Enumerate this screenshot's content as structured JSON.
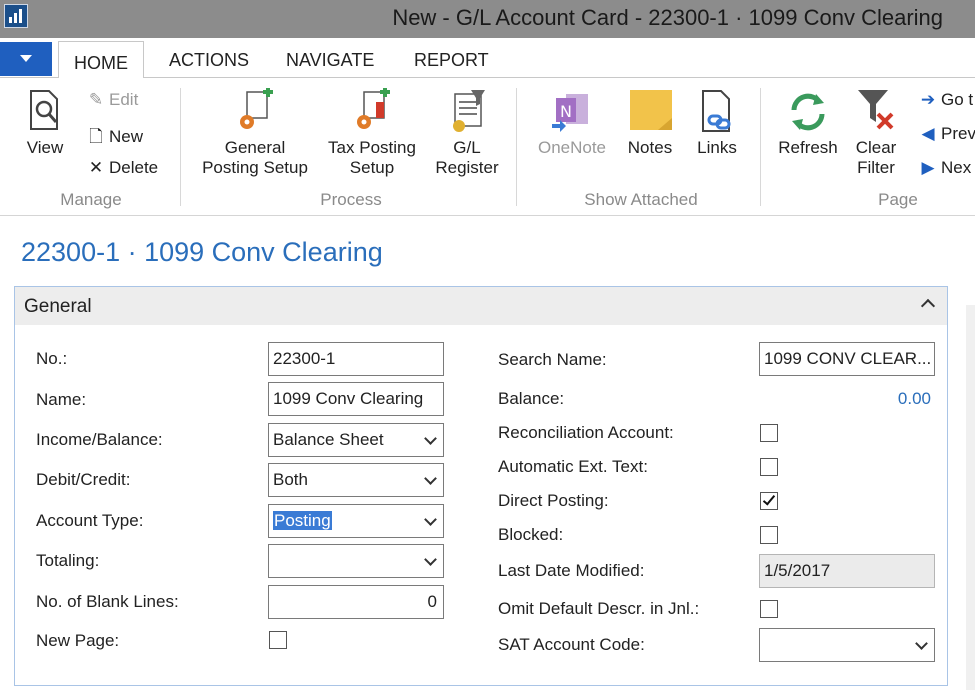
{
  "window": {
    "title": "New - G/L Account Card - 22300-1 · 1099 Conv Clearing"
  },
  "tabs": [
    "HOME",
    "ACTIONS",
    "NAVIGATE",
    "REPORT"
  ],
  "ribbon": {
    "manage": {
      "label": "Manage",
      "view": "View",
      "edit": "Edit",
      "new": "New",
      "delete": "Delete"
    },
    "process": {
      "label": "Process",
      "general_posting_setup": [
        "General",
        "Posting Setup"
      ],
      "tax_posting_setup": [
        "Tax Posting",
        "Setup"
      ],
      "gl_register": [
        "G/L",
        "Register"
      ]
    },
    "show_attached": {
      "label": "Show Attached",
      "onenote": "OneNote",
      "notes": "Notes",
      "links": "Links"
    },
    "page": {
      "label": "Page",
      "refresh": "Refresh",
      "clear_filter": [
        "Clear",
        "Filter"
      ],
      "go_to": "Go t",
      "previous": "Prev",
      "next": "Nex"
    }
  },
  "page_title": "22300-1 · 1099 Conv Clearing",
  "general": {
    "header": "General",
    "left": {
      "no": {
        "label": "No.:",
        "value": "22300-1"
      },
      "name": {
        "label": "Name:",
        "value": "1099 Conv Clearing"
      },
      "income_balance": {
        "label": "Income/Balance:",
        "value": "Balance Sheet"
      },
      "debit_credit": {
        "label": "Debit/Credit:",
        "value": "Both"
      },
      "account_type": {
        "label": "Account Type:",
        "value": "Posting"
      },
      "totaling": {
        "label": "Totaling:",
        "value": ""
      },
      "blank_lines": {
        "label": "No. of Blank Lines:",
        "value": "0"
      },
      "new_page": {
        "label": "New Page:",
        "checked": false
      }
    },
    "right": {
      "search_name": {
        "label": "Search Name:",
        "value": "1099 CONV CLEAR..."
      },
      "balance": {
        "label": "Balance:",
        "value": "0.00"
      },
      "reconciliation": {
        "label": "Reconciliation Account:",
        "checked": false
      },
      "auto_ext_text": {
        "label": "Automatic Ext. Text:",
        "checked": false
      },
      "direct_posting": {
        "label": "Direct Posting:",
        "checked": true
      },
      "blocked": {
        "label": "Blocked:",
        "checked": false
      },
      "last_modified": {
        "label": "Last Date Modified:",
        "value": "1/5/2017"
      },
      "omit_descr": {
        "label": "Omit Default Descr. in Jnl.:",
        "checked": false
      },
      "sat_code": {
        "label": "SAT Account Code:",
        "value": ""
      }
    }
  },
  "colors": {
    "accent": "#2a6ebb",
    "menu": "#1f5fbf",
    "titlebar": "#8c8c8c"
  }
}
